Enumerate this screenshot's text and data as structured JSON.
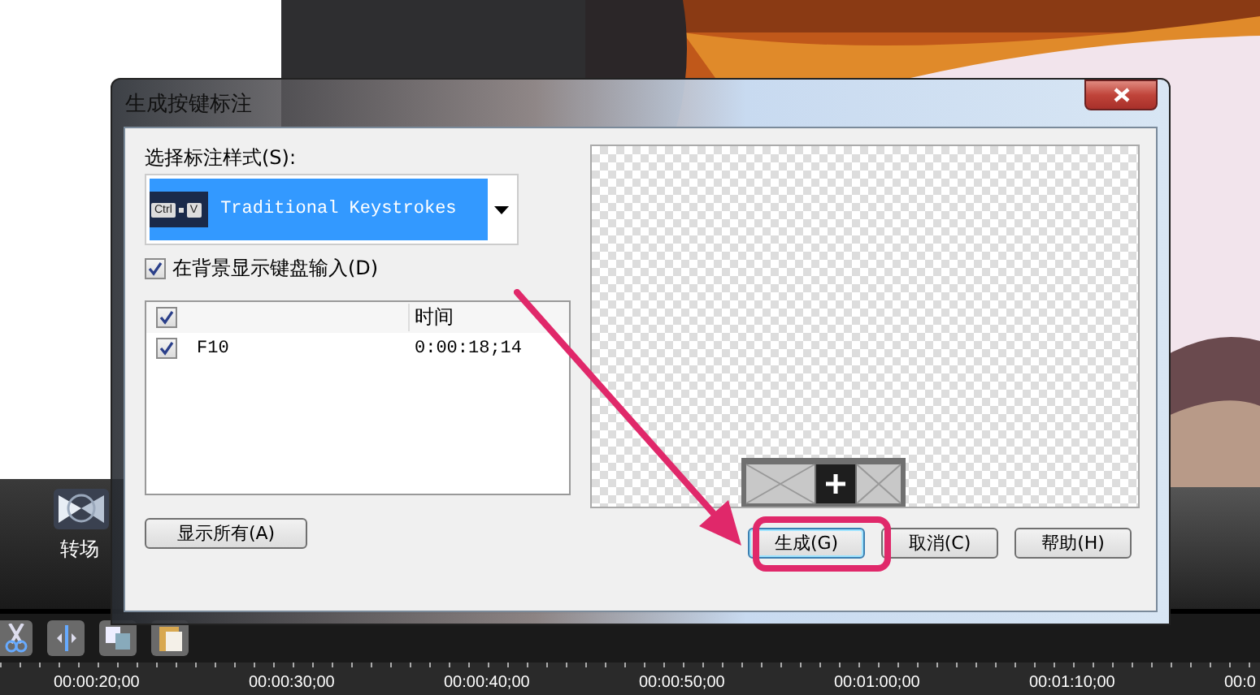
{
  "side_panel": {
    "label": "转场"
  },
  "dialog": {
    "title": "生成按键标注",
    "style_label": "选择标注样式(S):",
    "style_dropdown": {
      "keys": [
        "Ctrl",
        "V"
      ],
      "value": "Traditional Keystrokes"
    },
    "background_checkbox": {
      "label": "在背景显示键盘输入(D)",
      "checked": true
    },
    "keystroke_list": {
      "header_checked": true,
      "columns": [
        "时间"
      ],
      "rows": [
        {
          "key": "F10",
          "time": "0:00:18;14",
          "checked": true
        }
      ]
    },
    "show_all_button": "显示所有(A)",
    "buttons": [
      {
        "label": "生成(G)",
        "default": true,
        "highlighted": true
      },
      {
        "label": "取消(C)",
        "default": false,
        "highlighted": false
      },
      {
        "label": "帮助(H)",
        "default": false,
        "highlighted": false
      }
    ]
  },
  "timeline": {
    "ticks": [
      "00:00:20;00",
      "00:00:30;00",
      "00:00:40;00",
      "00:00:50;00",
      "00:01:00;00",
      "00:01:10;00",
      "00:0"
    ]
  }
}
